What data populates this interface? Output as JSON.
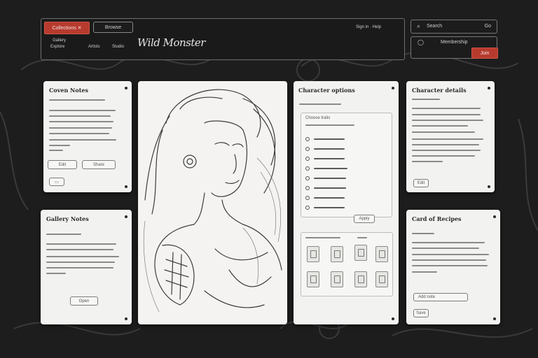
{
  "header": {
    "primary_button": "Collections ✕",
    "secondary_button": "Browse",
    "nav_links": [
      "Gallery",
      "Explore",
      "Artists",
      "Studio"
    ],
    "logo": "Wild Monster",
    "top_right_link": "Sign in · Help",
    "search_placeholder": "Search",
    "search_shortcut": "Go",
    "account_label": "Membership",
    "account_button": "Join"
  },
  "cards": {
    "c1": {
      "title": "Coven Notes",
      "btn1": "Edit",
      "btn2": "Share"
    },
    "c2": {
      "title": "Gallery Notes",
      "btn1": "Open"
    },
    "c3": {
      "title": "Character options",
      "section": "Choose traits",
      "confirm": "Apply"
    },
    "c4": {
      "title": "Character details",
      "btn1": "Edit"
    },
    "c5": {
      "title": "Card of Recipes",
      "field": "Add note",
      "btn1": "Save"
    }
  },
  "colors": {
    "accent": "#b73a2e",
    "background": "#1d1d1d",
    "card": "#f2f2f0"
  },
  "icons": [
    "menu-dot-icon",
    "radio-icon",
    "card-thumbnail-icon"
  ]
}
